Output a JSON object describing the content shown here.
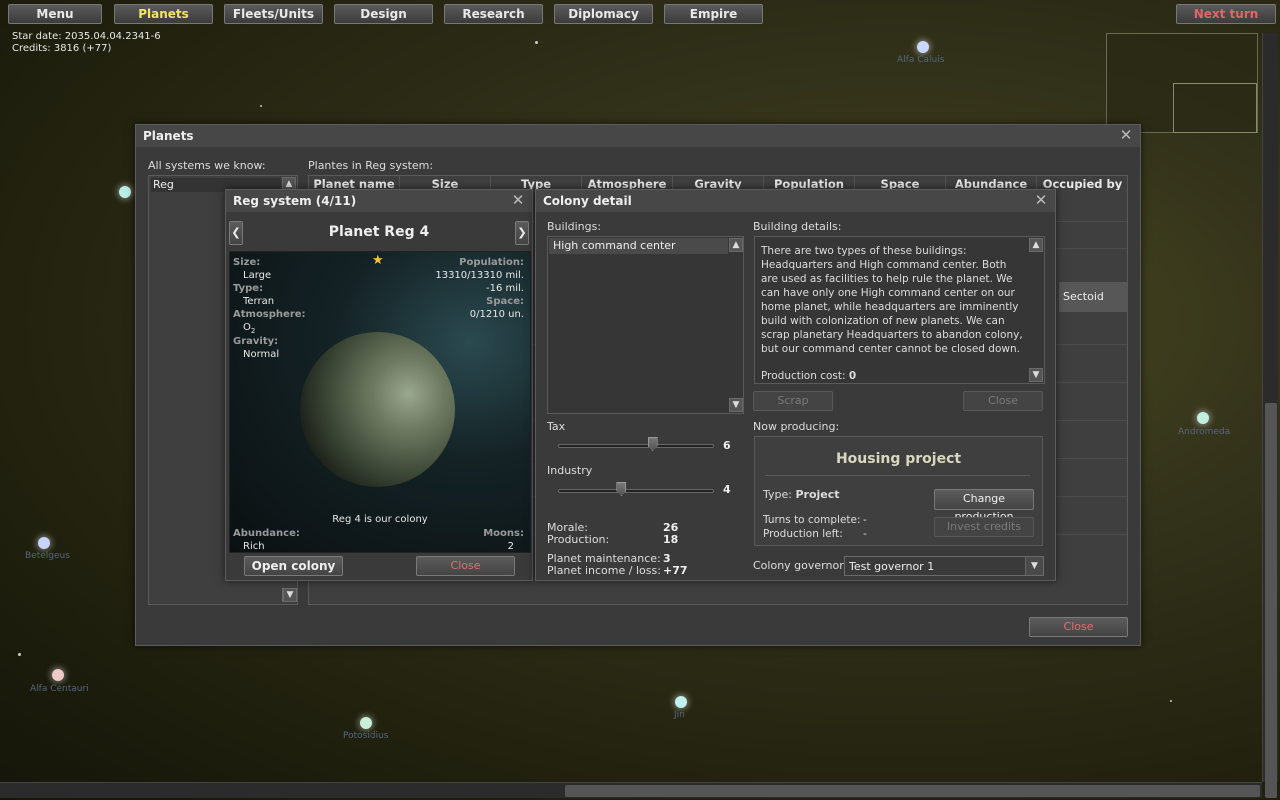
{
  "topbar": {
    "menu": "Menu",
    "planets": "Planets",
    "fleets": "Fleets/Units",
    "design": "Design",
    "research": "Research",
    "diplomacy": "Diplomacy",
    "empire": "Empire",
    "next_turn": "Next turn"
  },
  "hud": {
    "star_date": "Star date: 2035.04.04.2341-6",
    "credits": "Credits: 3816 (+77)"
  },
  "stars": {
    "alfa_caluis": "Alfa Caluis",
    "andromeda": "Andromeda",
    "alfa_centauri": "Alfa Centauri",
    "potosidius": "Potosidius",
    "jin": "Jin",
    "left_star": "Betelgeus"
  },
  "planets_window": {
    "title": "Planets",
    "systems_label": "All systems we know:",
    "selected_system": "Reg",
    "planets_label": "Plantes in Reg system:",
    "columns": [
      "Planet name",
      "Size",
      "Type",
      "Atmosphere",
      "Gravity",
      "Population",
      "Space",
      "Abundance",
      "Occupied by"
    ],
    "visible_occupied": "Sectoid",
    "close": "Close"
  },
  "reg_window": {
    "title": "Reg system (4/11)",
    "planet_name": "Planet Reg 4",
    "size_label": "Size:",
    "size": "Large",
    "type_label": "Type:",
    "type": "Terran",
    "atmosphere_label": "Atmosphere:",
    "atmosphere": "O",
    "atmosphere_sub": "2",
    "gravity_label": "Gravity:",
    "gravity": "Normal",
    "population_label": "Population:",
    "population": "13310/13310 mil.",
    "population_change": "-16 mil.",
    "space_label": "Space:",
    "space": "0/1210 un.",
    "colony_note": "Reg 4 is our colony",
    "abundance_label": "Abundance:",
    "abundance": "Rich",
    "moons_label": "Moons:",
    "moons": "2",
    "open_colony": "Open colony",
    "close": "Close"
  },
  "colony_window": {
    "title": "Colony detail",
    "buildings_label": "Buildings:",
    "buildings": [
      "High command center"
    ],
    "building_details_label": "Building details:",
    "building_details": "There are two types of these buildings: Headquarters and High command center. Both are used as facilities to help rule the planet. We can have only one High command center on our home planet, while headquarters are imminently build with colonization of new planets. We can scrap planetary Headquarters to abandon colony, but our command center cannot be closed down.",
    "production_cost_label": "Production cost:",
    "production_cost": "0",
    "scrap": "Scrap",
    "close_details": "Close",
    "tax_label": "Tax",
    "tax_value": "6",
    "tax_fraction": 0.6,
    "industry_label": "Industry",
    "industry_value": "4",
    "industry_fraction": 0.4,
    "morale_label": "Morale:",
    "morale": "26",
    "production_label": "Production:",
    "production": "18",
    "maintenance_label": "Planet maintenance:",
    "maintenance": "3",
    "income_label": "Planet income / loss:",
    "income": "+77",
    "now_producing_label": "Now producing:",
    "project_name": "Housing project",
    "type_label": "Type:",
    "type_value": "Project",
    "change_production": "Change production",
    "turns_label": "Turns to complete:",
    "turns_value": "-",
    "production_left_label": "Production left:",
    "production_left_value": "-",
    "invest_credits": "Invest credits",
    "governor_label": "Colony governor:",
    "governor": "Test governor 1"
  }
}
